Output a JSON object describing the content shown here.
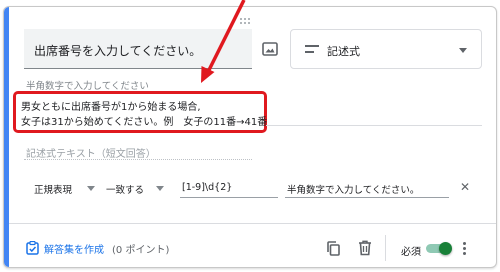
{
  "question": {
    "title": "出席番号を入力してください。"
  },
  "question_type": {
    "label": "記述式",
    "icon": "short-answer-icon"
  },
  "description": {
    "hint": "半角数字で入力してください",
    "line1": "男女ともに出席番号が1から始まる場合,",
    "line2": "女子は31から始めてください。例　女子の11番→41番"
  },
  "answer": {
    "placeholder": "記述式テキスト（短文回答）"
  },
  "validation": {
    "type": "正規表現",
    "condition": "一致する",
    "pattern": "[1-9]\\d{2}",
    "error_text": "半角数字で入力してください。"
  },
  "footer": {
    "answer_key": "解答集を作成",
    "points": "(0 ポイント)",
    "required": "必須",
    "required_on": true
  },
  "colors": {
    "accent": "#4285f4",
    "highlight": "#e0191f",
    "link": "#1a73e8",
    "toggle": "#188038"
  }
}
